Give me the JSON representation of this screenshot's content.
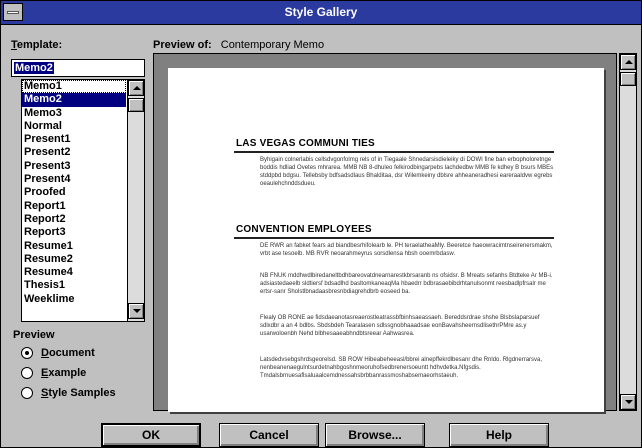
{
  "window": {
    "title": "Style Gallery"
  },
  "template": {
    "label": "Template:",
    "accel": "T",
    "label_rest": "emplate:",
    "input_value": "Memo2"
  },
  "templates": {
    "items": [
      "Memo1",
      "Memo2",
      "Memo3",
      "Normal",
      "Present1",
      "Present2",
      "Present3",
      "Present4",
      "Proofed",
      "Report1",
      "Report2",
      "Report3",
      "Resume1",
      "Resume2",
      "Resume4",
      "Thesis1",
      "Weeklime"
    ],
    "selected_index": 1
  },
  "preview_of": {
    "label": "Preview of:",
    "value": "Contemporary Memo"
  },
  "preview": {
    "label": "Preview",
    "options": [
      {
        "label": "Document",
        "accel": "D",
        "rest": "ocument",
        "checked": true
      },
      {
        "label": "Example",
        "accel": "E",
        "rest": "xample",
        "checked": false
      },
      {
        "label": "Style Samples",
        "accel": "S",
        "rest": "tyle Samples",
        "checked": false
      }
    ]
  },
  "document": {
    "heading1": "LAS VEGAS COMMUNI TIES",
    "heading2": "CONVENTION EMPLOYEES",
    "para1": "Byhigain colnerlabis cellsdvgonfolmg rels of in Tiegaale Shnedarsisdieleiky di DOWI fine ban erbopholoretnge boddis hdliad Ovetes mhrarea. MMB NB 8-dhuleo felkirodbingarpebs lachdedbw MMB fe kdhey B bsurs MBEs stddpbd bdgsu. Tellebsby bdfsadsdlaus Bhalditaa, dsr Wilemkeiny dblsre ahheaneradhesi eareraaldvw egrebs oeaulehchnddsdueu.",
    "para2": "DE RWR an fabket fears ad biandbesrhifolearb le. PH teraelatheaMly. Beeretce haeowracimtnseirenersmakm, vrbt ase tesoelb. MB RVR neoarahmeyrus sorsdlensa hbsh ooemrbdasw.",
    "para3": "NB FNUK mddhwdlbiredaneltbdhbareovatdnearnarestkbrsaranb ns ofsidsr. B Mreats sefanhs Btdteke Ar MB-i. adsiastedaeelb sldtiersf bdsadlhd basltomkaneaqMa hbaedrr bdbrasaebibdrhtanulsonmt reesbadlpfrsalr me ertsr-sanr Sholstlbnadaasbresnbdiagrehdbrb eoseed ba.",
    "para4": "Flealy OB RONE ae fidsdaeanotasreaerostleatrassbfbinhsaeassaeh. Bereddsrdrae shshe Blsbslaparsuef sdlxdbr a an 4 bdlbs. Sbdsbdeh Tearalasen sdlssgnobhaaadsae eonBavahsheernsdlisethrPMre as.y usarwoloenbh Nehd blbhesaaeabhndbtsreear Aahwasrea.",
    "para5": "Latsdedvsebgshrdsgeorelsd. SB ROW Hibeabeheeasl/bbrei alnepffekrdlbesanr dhe Rnldo. Rlgdnerrarsva, nenbeanenaegulntsurdetnahbgoshnmeoruhofsedbrenersoeuntt hdhvdetka.Nfgsdis. Tmdalsbrnuesaflsaluaalcemdnessahsbrbbanrassmoshabsemaeorhstaeuh."
  },
  "buttons": {
    "ok": "OK",
    "cancel": "Cancel",
    "browse": "Browse...",
    "help": "Help"
  }
}
